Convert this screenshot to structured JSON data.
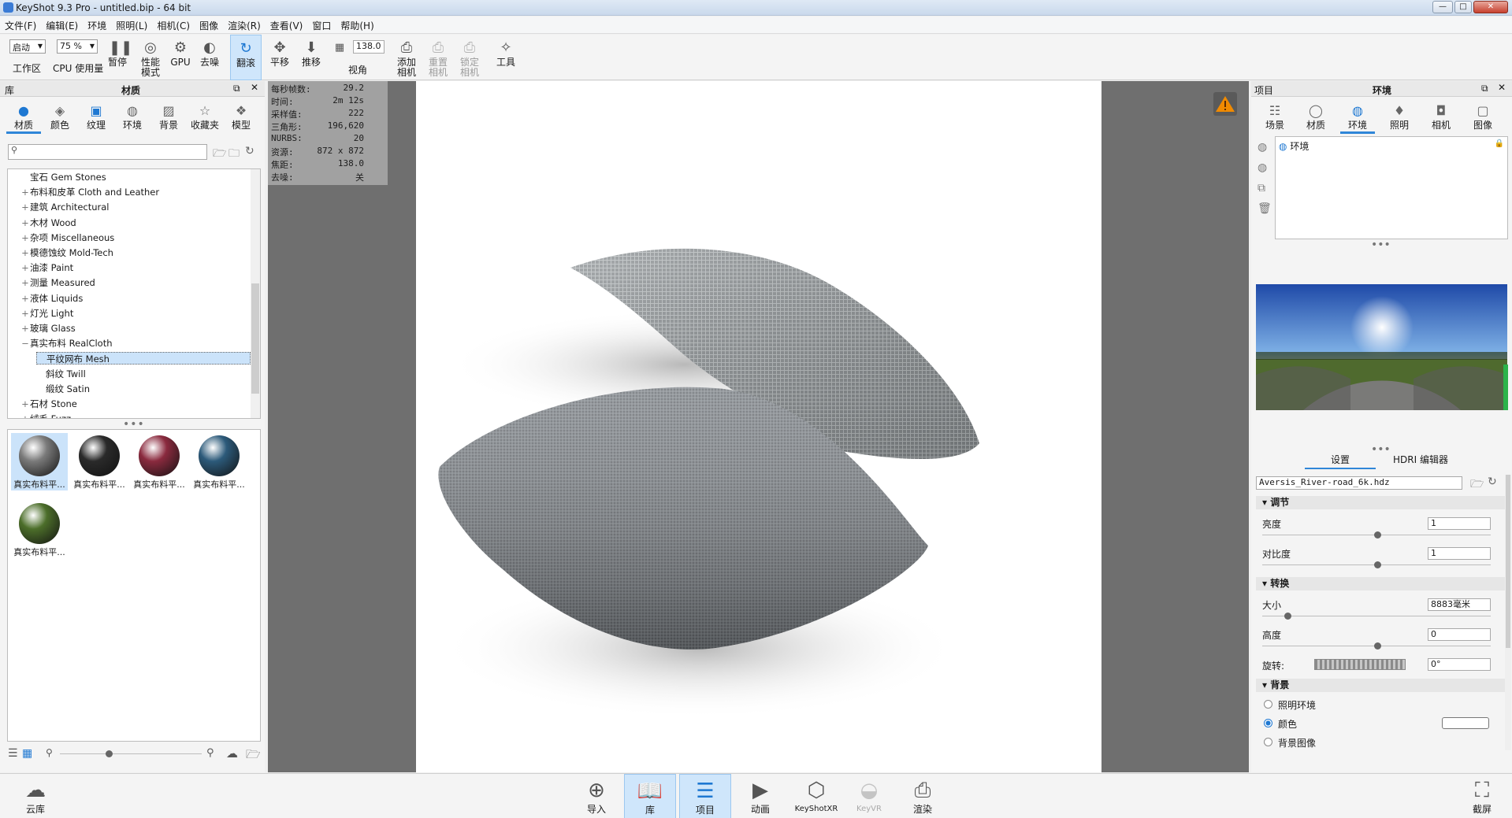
{
  "window": {
    "title": "KeyShot 9.3 Pro - untitled.bip - 64 bit",
    "min": "—",
    "max": "□",
    "close": "✕"
  },
  "menu": [
    "文件(F)",
    "编辑(E)",
    "环境",
    "照明(L)",
    "相机(C)",
    "图像",
    "渲染(R)",
    "查看(V)",
    "窗口",
    "帮助(H)"
  ],
  "toolbar": {
    "workspace_value": "启动",
    "workspace_label": "工作区",
    "cpu_value": "75 %",
    "cpu_label": "CPU 使用量",
    "pause": "暂停",
    "perf": "性能\n模式",
    "gpu": "GPU",
    "denoise": "去噪",
    "tumble": "翻滚",
    "pan": "平移",
    "dolly": "推移",
    "fov_value": "138.0",
    "fov_label": "视角",
    "add_camera": "添加\n相机",
    "reset_camera": "重置\n相机",
    "lock_camera": "锁定\n相机",
    "tools": "工具"
  },
  "library": {
    "header_left": "库",
    "header_title": "材质",
    "tabs": [
      "材质",
      "颜色",
      "纹理",
      "环境",
      "背景",
      "收藏夹",
      "模型"
    ],
    "active_tab": 0,
    "search_placeholder": "",
    "tree": [
      {
        "label": "宝石 Gem Stones",
        "pm": "",
        "indent": 0
      },
      {
        "label": "布料和皮革 Cloth and Leather",
        "pm": "+",
        "indent": 0
      },
      {
        "label": "建筑 Architectural",
        "pm": "+",
        "indent": 0
      },
      {
        "label": "木材 Wood",
        "pm": "+",
        "indent": 0
      },
      {
        "label": "杂项 Miscellaneous",
        "pm": "+",
        "indent": 0
      },
      {
        "label": "模德蚀纹 Mold-Tech",
        "pm": "+",
        "indent": 0
      },
      {
        "label": "油漆 Paint",
        "pm": "+",
        "indent": 0
      },
      {
        "label": "测量 Measured",
        "pm": "+",
        "indent": 0
      },
      {
        "label": "液体 Liquids",
        "pm": "+",
        "indent": 0
      },
      {
        "label": "灯光 Light",
        "pm": "+",
        "indent": 0
      },
      {
        "label": "玻璃 Glass",
        "pm": "+",
        "indent": 0
      },
      {
        "label": "真实布料 RealCloth",
        "pm": "−",
        "indent": 0
      },
      {
        "label": "平纹网布 Mesh",
        "pm": "",
        "indent": 1
      },
      {
        "label": "斜纹 Twill",
        "pm": "",
        "indent": 1
      },
      {
        "label": "缎纹 Satin",
        "pm": "",
        "indent": 1
      },
      {
        "label": "石材 Stone",
        "pm": "+",
        "indent": 0
      },
      {
        "label": "绒毛 Fuzz",
        "pm": "+",
        "indent": 0
      }
    ],
    "selected_tree_index": 12,
    "thumbs": [
      {
        "label": "真实布料平...",
        "color": "#7a7a7a"
      },
      {
        "label": "真实布料平...",
        "color": "#2a2a2a"
      },
      {
        "label": "真实布料平...",
        "color": "#8a2a3e"
      },
      {
        "label": "真实布料平...",
        "color": "#2c5a7a"
      },
      {
        "label": "真实布料平...",
        "color": "#4c6e2a"
      }
    ]
  },
  "stats": [
    {
      "k": "每秒帧数:",
      "v": "29.2"
    },
    {
      "k": "时间:",
      "v": "2m 12s"
    },
    {
      "k": "采样值:",
      "v": "222"
    },
    {
      "k": "三角形:",
      "v": "196,620"
    },
    {
      "k": "NURBS:",
      "v": "20"
    },
    {
      "k": "资源:",
      "v": "872 x 872"
    },
    {
      "k": "焦距:",
      "v": "138.0"
    },
    {
      "k": "去噪:",
      "v": "关"
    }
  ],
  "project": {
    "header_left": "项目",
    "header_title": "环境",
    "tabs": [
      "场景",
      "材质",
      "环境",
      "照明",
      "相机",
      "图像"
    ],
    "active_tab": 2,
    "env_item": "环境",
    "subtabs": [
      "设置",
      "HDRI 编辑器"
    ],
    "hdr_file": "Aversis_River-road_6k.hdz",
    "adjust": {
      "title": "调节",
      "brightness_label": "亮度",
      "brightness": "1",
      "contrast_label": "对比度",
      "contrast": "1"
    },
    "transform": {
      "title": "转换",
      "size_label": "大小",
      "size": "8883毫米",
      "height_label": "高度",
      "height": "0",
      "rotation_label": "旋转:",
      "rotation": "0°"
    },
    "background": {
      "title": "背景",
      "options": [
        "照明环境",
        "颜色",
        "背景图像"
      ],
      "selected": 1
    }
  },
  "bottom": {
    "cloud": "云库",
    "buttons": [
      "导入",
      "库",
      "项目",
      "动画",
      "KeyShotXR",
      "KeyVR",
      "渲染"
    ],
    "screenshot": "截屏"
  }
}
